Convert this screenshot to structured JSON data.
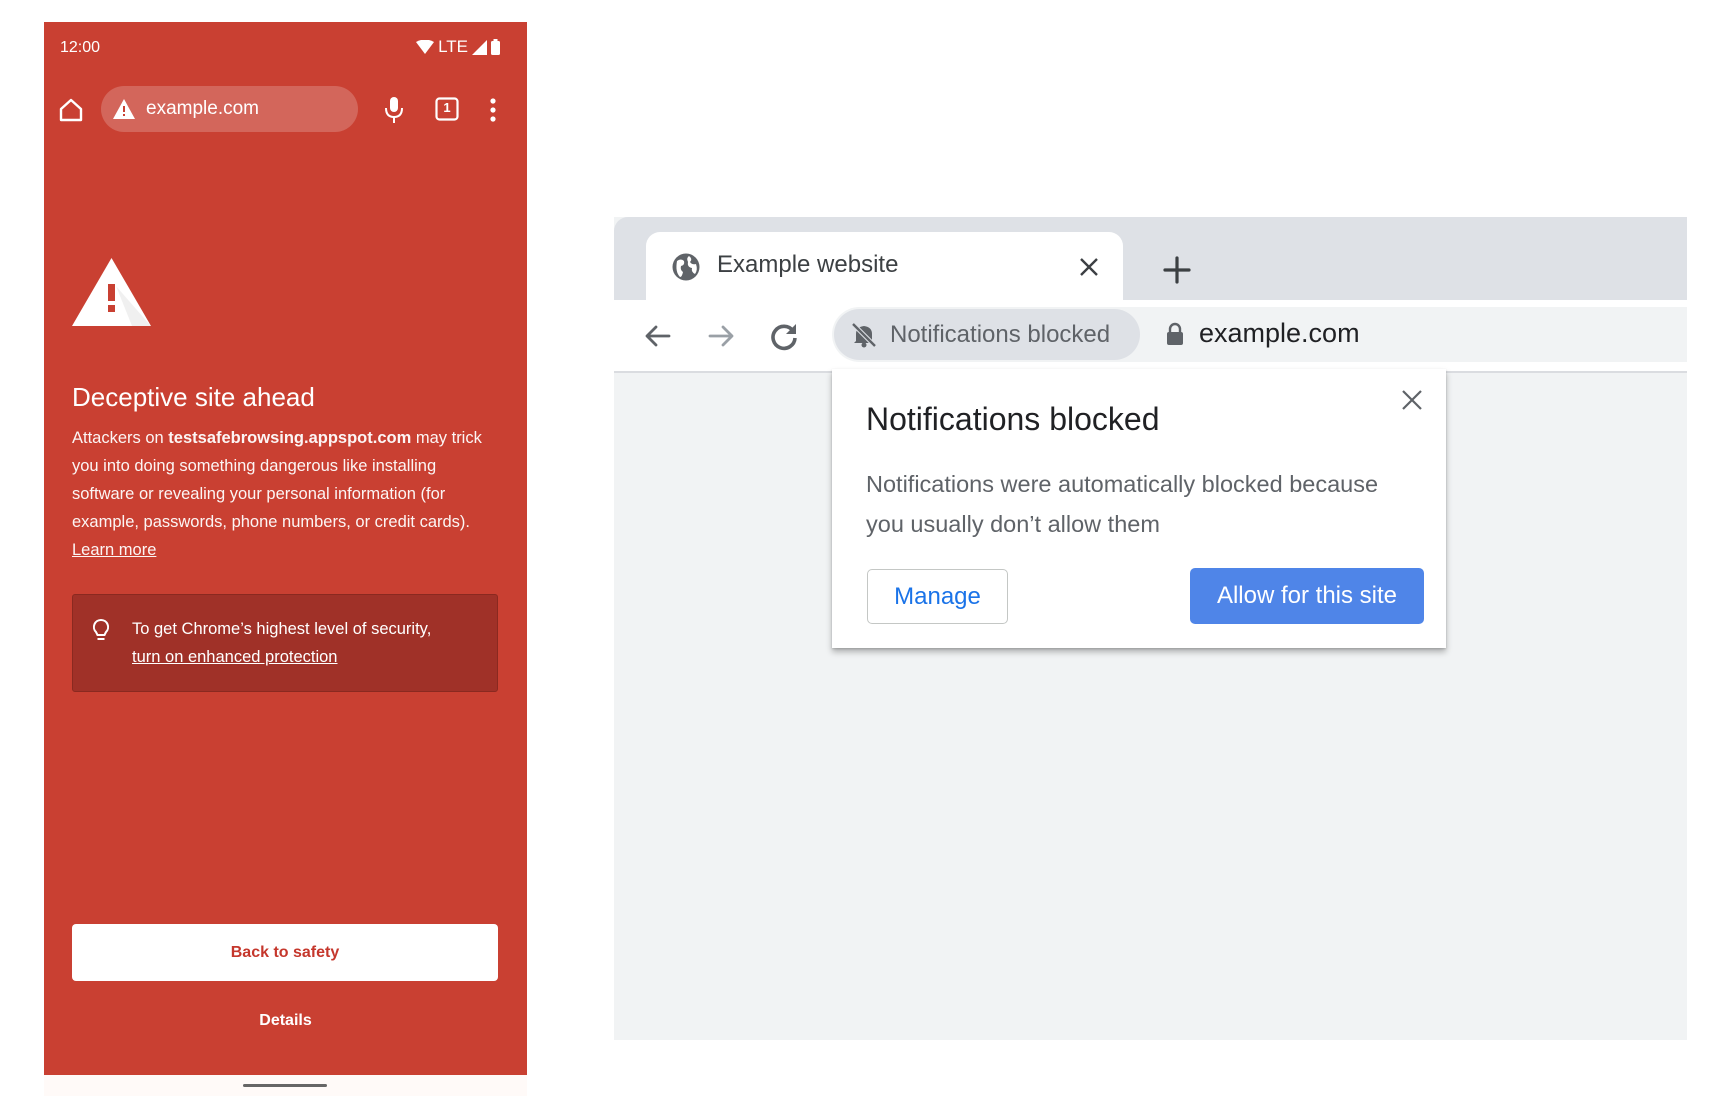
{
  "phone": {
    "status_bar": {
      "time": "12:00",
      "network": "LTE"
    },
    "toolbar": {
      "url": "example.com",
      "tab_count": "1"
    },
    "interstitial": {
      "title": "Deceptive site ahead",
      "body_prefix": "Attackers on ",
      "body_domain": "testsafebrowsing.appspot.com",
      "body_suffix": " may trick you into doing something dangerous like installing software or revealing your personal information (for example, passwords, phone numbers, or credit cards).",
      "learn_more": "Learn more",
      "tip_text": "To get Chrome’s highest level of security,",
      "tip_link": "turn on enhanced protection",
      "back_button": "Back to safety",
      "details_link": "Details"
    },
    "colors": {
      "background": "#c94032",
      "tip_background": "#a03128",
      "back_button_text": "#c5372c"
    }
  },
  "browser": {
    "tab": {
      "title": "Example website"
    },
    "omnibox": {
      "chip_label": "Notifications blocked",
      "url": "example.com"
    },
    "popup": {
      "title": "Notifications blocked",
      "body": "Notifications were automatically blocked because you usually don’t allow them",
      "manage_button": "Manage",
      "allow_button": "Allow for this site"
    },
    "colors": {
      "accent": "#4f85e8",
      "link": "#1a73e8",
      "tabstrip": "#dee1e6",
      "content": "#f1f3f4"
    }
  }
}
